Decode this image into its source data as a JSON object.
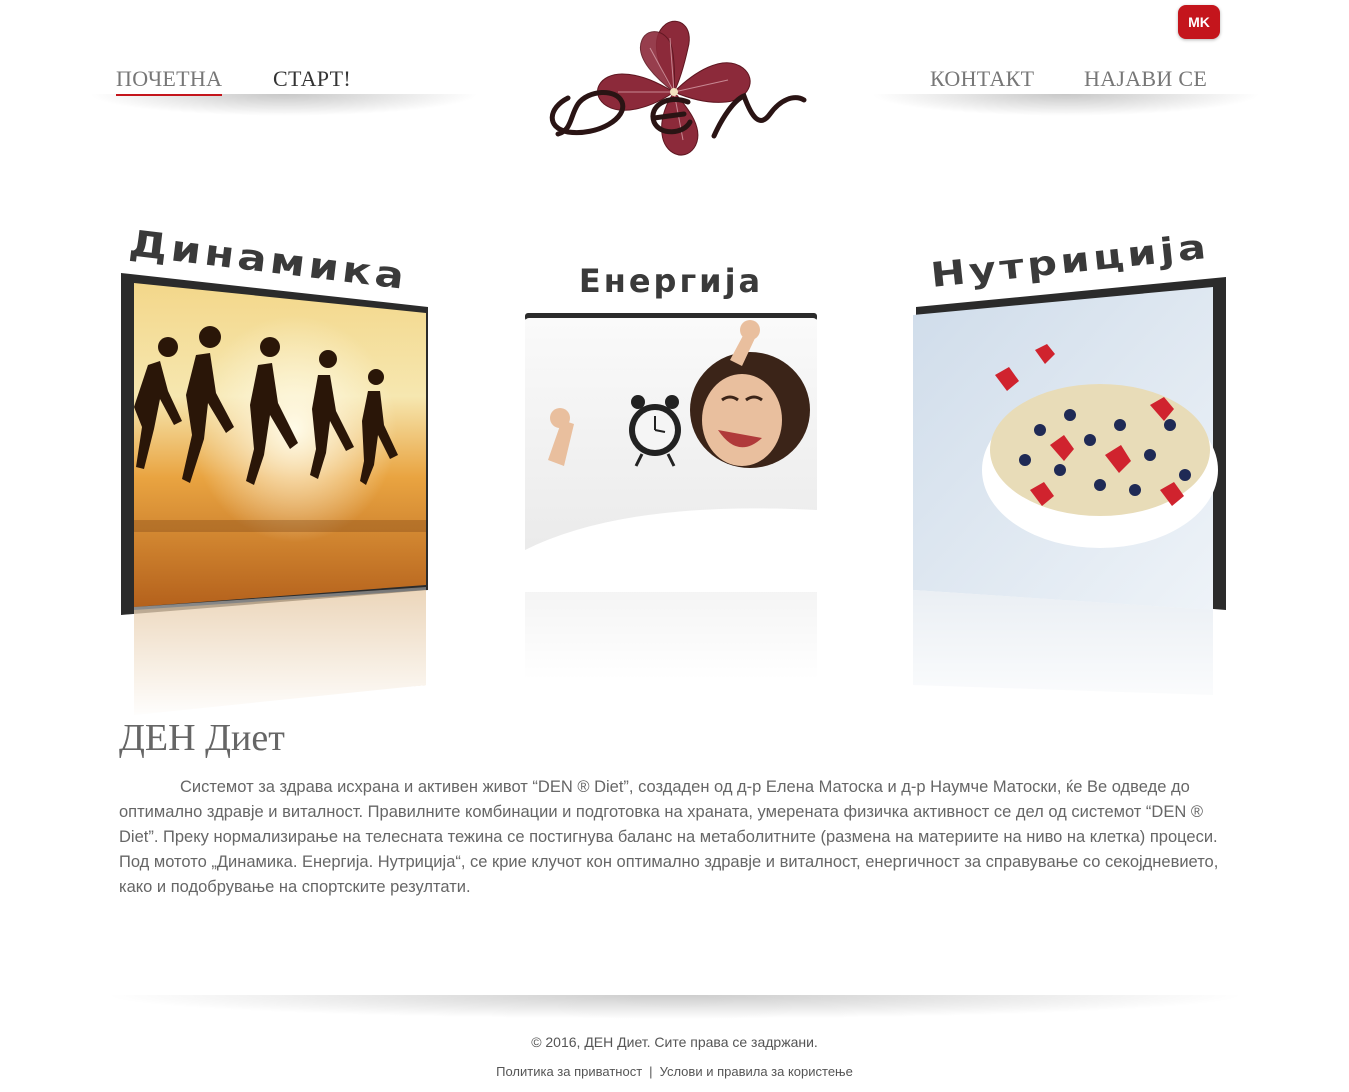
{
  "language_badge": "MK",
  "nav": {
    "left": [
      {
        "label": "ПОЧЕТНА",
        "active": true
      },
      {
        "label": "СТАРТ!",
        "active": false
      }
    ],
    "right": [
      {
        "label": "КОНТАКТ"
      },
      {
        "label": "НАЈАВИ СЕ"
      }
    ]
  },
  "logo": {
    "text": "DEN",
    "flower_color": "#8c2a3a"
  },
  "features": [
    {
      "headline": "Динамика",
      "image": "runners-at-sunset"
    },
    {
      "headline": "Енергија",
      "image": "woman-waking-with-alarm-clock"
    },
    {
      "headline": "Нутриција",
      "image": "oatmeal-with-berries"
    }
  ],
  "article": {
    "title": "ДЕН Диет",
    "body": "Системот за здрава исхрана и активен живот “DEN ® Diet”, создаден од д-р Елена Матоска и д-р Наумче Матоски, ќе Ве одведе до оптимално здравје и виталност. Правилните комбинации и подготовка на храната, умерената физичка активност се дел од системот “DEN ® Diet”. Преку нормализирање на телесната тежина се постигнува баланс на метаболитните (размена на материите на ниво на клетка) процеси. Под мотото „Динамика. Енергија. Нутриција“, се крие клучот кон оптимално здравје и виталност, енергичност за справување со секојдневието, како и подобрување на спортските резултати."
  },
  "footer": {
    "copyright": "© 2016, ДЕН Диет. Сите права се задржани.",
    "links": [
      "Политика за приватност",
      "Услови и правила за користење"
    ]
  },
  "colors": {
    "accent": "#c4151c",
    "headline": "#3a3a3a",
    "body_text": "#666666"
  }
}
